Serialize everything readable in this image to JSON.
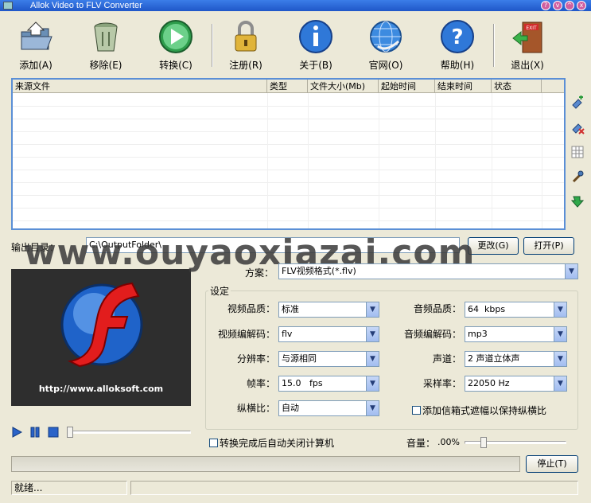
{
  "window": {
    "title": "Allok Video to FLV Converter"
  },
  "toolbar": {
    "items": [
      {
        "label": "添加(A)",
        "icon": "folder-add-icon"
      },
      {
        "label": "移除(E)",
        "icon": "trash-can-icon"
      },
      {
        "label": "转换(C)",
        "icon": "play-convert-icon"
      },
      {
        "label": "注册(R)",
        "icon": "padlock-icon"
      },
      {
        "label": "关于(B)",
        "icon": "info-icon"
      },
      {
        "label": "官网(O)",
        "icon": "globe-web-icon"
      },
      {
        "label": "帮助(H)",
        "icon": "help-question-icon"
      },
      {
        "label": "退出(X)",
        "icon": "exit-door-icon"
      }
    ]
  },
  "filelist": {
    "columns": [
      "来源文件",
      "类型",
      "文件大小(Mb)",
      "起始时间",
      "结束时间",
      "状态"
    ],
    "rows": []
  },
  "sidebar_icons": [
    "add-file-icon",
    "remove-file-icon",
    "grid-icon",
    "tools-icon",
    "move-arrow-icon"
  ],
  "output": {
    "label": "输出目录：",
    "path": "C:\\OutputFolder\\",
    "change_button": "更改(G)",
    "open_button": "打开(P)"
  },
  "watermark": "www.ouyaoxiazai.com",
  "preview": {
    "url": "http://www.alloksoft.com"
  },
  "profile": {
    "label": "方案：",
    "value": "FLV视频格式(*.flv)"
  },
  "settings": {
    "legend": "设定",
    "video_quality": {
      "label": "视频品质：",
      "value": "标准"
    },
    "video_codec": {
      "label": "视频编解码：",
      "value": "flv"
    },
    "resolution": {
      "label": "分辨率：",
      "value": "与源相同"
    },
    "frame_rate": {
      "label": "帧率：",
      "value": "15.0   fps"
    },
    "aspect_ratio": {
      "label": "纵横比：",
      "value": "自动"
    },
    "audio_quality": {
      "label": "音频品质：",
      "value": "64  kbps"
    },
    "audio_codec": {
      "label": "音频编解码：",
      "value": "mp3"
    },
    "channels": {
      "label": "声道：",
      "value": "2 声道立体声"
    },
    "sample_rate": {
      "label": "采样率：",
      "value": "22050 Hz"
    },
    "letterbox_checkbox": "添加信箱式遮幅以保持纵横比"
  },
  "shutdown_checkbox": "转换完成后自动关闭计算机",
  "volume": {
    "label": "音量：",
    "value": ".00%"
  },
  "progress": {
    "fraction": 0
  },
  "stop_button": "停止(T)",
  "status": {
    "text": "就绪...",
    "detail": ""
  },
  "colors": {
    "accent": "#5b8fd6",
    "titlebar": "#1f57c8",
    "window_bg": "#ece9d8"
  }
}
